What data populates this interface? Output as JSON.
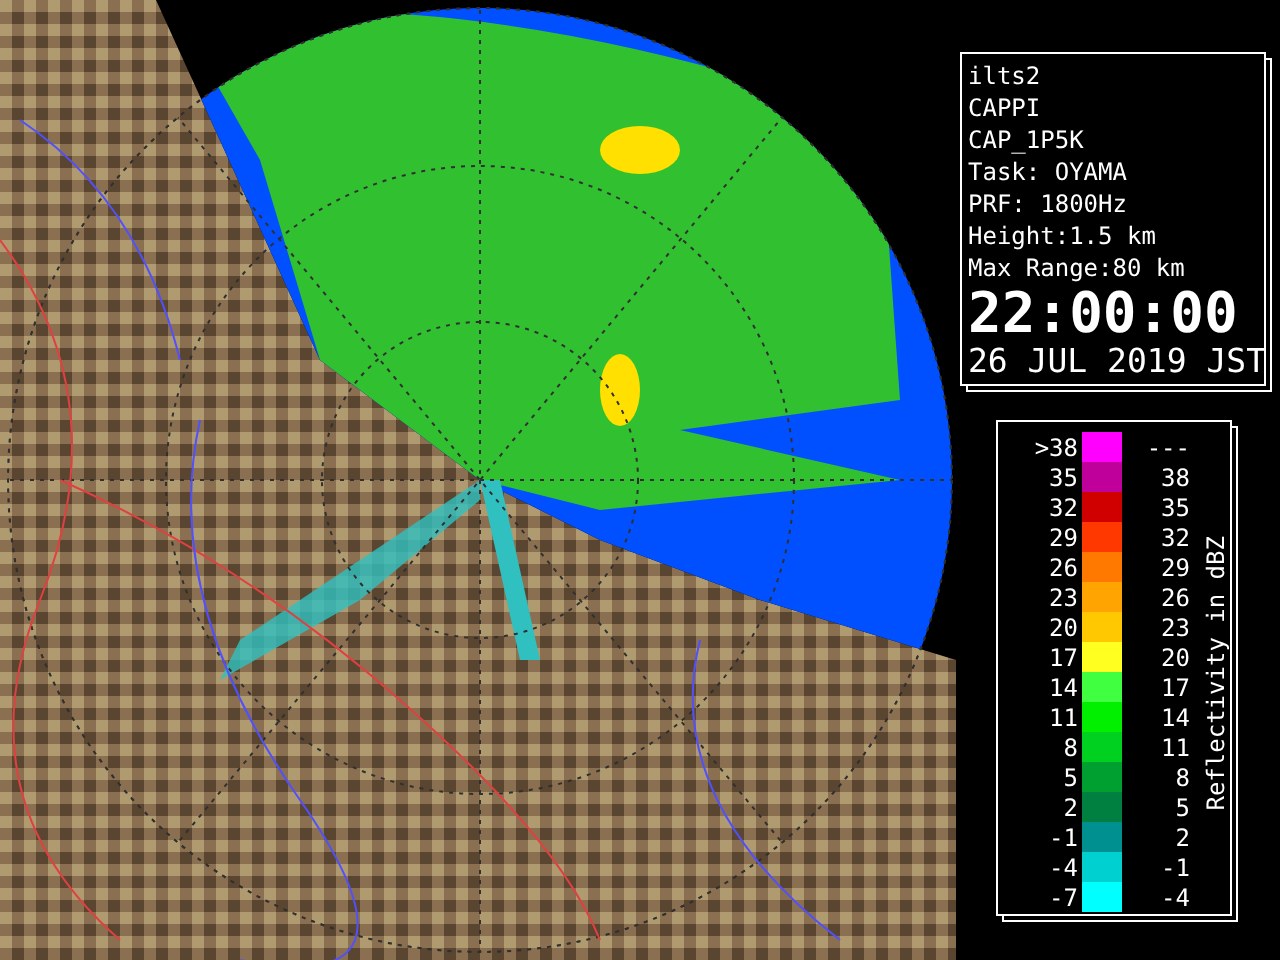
{
  "info_panel": {
    "lines": [
      "ilts2",
      "CAPPI",
      "CAP_1P5K",
      "Task: OYAMA",
      "PRF: 1800Hz",
      "Height:1.5 km",
      "Max Range:80 km"
    ],
    "time": "22:00:00",
    "date": "26 JUL 2019 JST"
  },
  "legend": {
    "title": "Reflectivity in dBZ",
    "rows": [
      {
        "low": ">38",
        "high": "---",
        "color": "#ff00ff"
      },
      {
        "low": "35",
        "high": "38",
        "color": "#c0009a"
      },
      {
        "low": "32",
        "high": "35",
        "color": "#d00000"
      },
      {
        "low": "29",
        "high": "32",
        "color": "#ff3800"
      },
      {
        "low": "26",
        "high": "29",
        "color": "#ff7800"
      },
      {
        "low": "23",
        "high": "26",
        "color": "#ffa400"
      },
      {
        "low": "20",
        "high": "23",
        "color": "#ffc800"
      },
      {
        "low": "17",
        "high": "20",
        "color": "#ffff20"
      },
      {
        "low": "14",
        "high": "17",
        "color": "#40ff40"
      },
      {
        "low": "11",
        "high": "14",
        "color": "#00f000"
      },
      {
        "low": "8",
        "high": "11",
        "color": "#00d020"
      },
      {
        "low": "5",
        "high": "8",
        "color": "#00a030"
      },
      {
        "low": "2",
        "high": "5",
        "color": "#008040"
      },
      {
        "low": "-1",
        "high": "2",
        "color": "#009090"
      },
      {
        "low": "-4",
        "high": "-1",
        "color": "#00d0d0"
      },
      {
        "low": "-7",
        "high": "-4",
        "color": "#00ffff"
      }
    ]
  }
}
